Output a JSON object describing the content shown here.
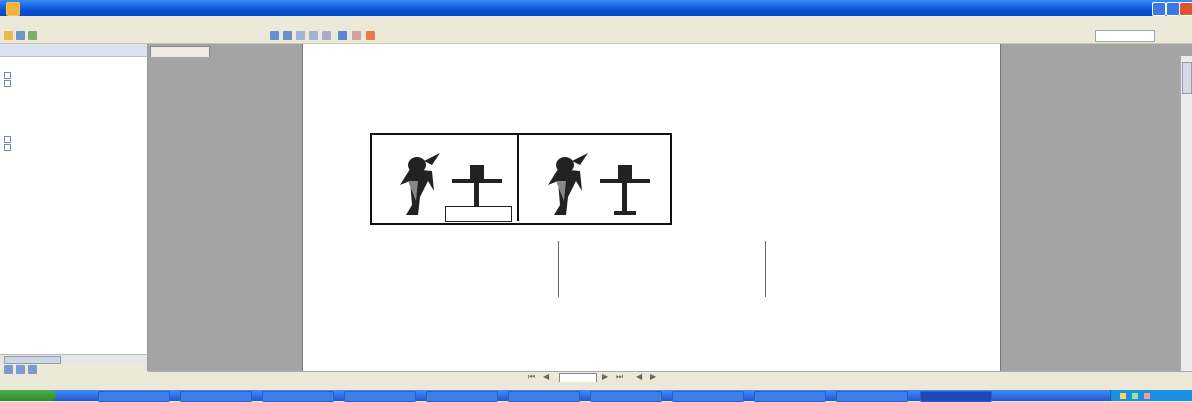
{
  "window": {
    "title": ""
  },
  "menu": {
    "items": [
      "",
      "",
      "",
      "",
      ""
    ]
  },
  "toolbar": {
    "zoom": "",
    "search_placeholder": ""
  },
  "sidebar": {
    "header": "",
    "items": [
      "",
      "",
      "",
      "",
      "",
      "",
      "",
      "",
      "",
      "",
      "",
      "",
      "",
      "",
      ""
    ]
  },
  "document": {
    "tab": "",
    "para1": [
      "",
      "",
      ""
    ],
    "insert_title": "",
    "steps": [
      "",
      "",
      "",
      "",
      "",
      ""
    ],
    "caption": "",
    "columns_intro": "",
    "columns": [
      {
        "title": "",
        "subtitle": "",
        "rows": [
          "",
          "",
          "",
          ""
        ]
      },
      {
        "title": "",
        "subtitle": "",
        "rows": [
          "",
          "",
          "",
          ""
        ]
      },
      {
        "title": "",
        "subtitle": "",
        "rows": [
          "",
          "",
          "",
          ""
        ]
      }
    ]
  },
  "nav": {
    "page_box": ""
  },
  "taskbar": {
    "start": "",
    "buttons": [
      "",
      "",
      "",
      "",
      "",
      "",
      "",
      "",
      "",
      "",
      ""
    ]
  },
  "colors": {
    "title_bar": "#0a53d8",
    "taskbar": "#2459d4",
    "start": "#2f8a2f"
  }
}
